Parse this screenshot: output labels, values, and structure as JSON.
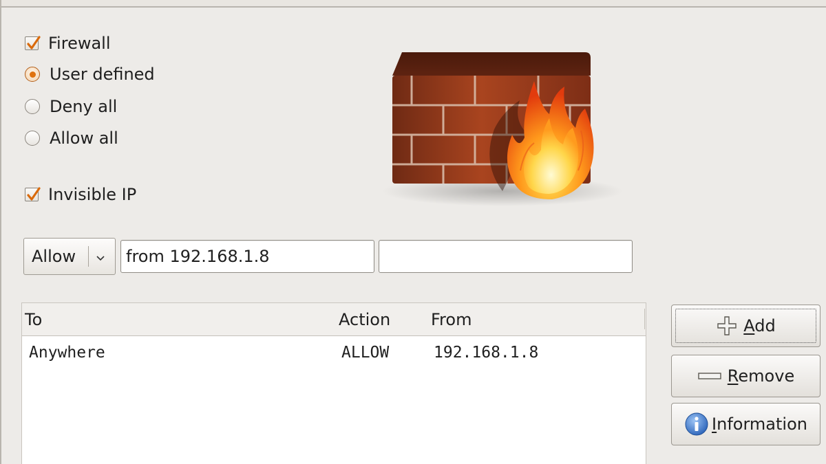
{
  "options": {
    "firewall": {
      "label": "Firewall",
      "checked": true
    },
    "user_defined": {
      "label": "User defined",
      "selected": true
    },
    "deny_all": {
      "label": "Deny all",
      "selected": false
    },
    "allow_all": {
      "label": "Allow all",
      "selected": false
    },
    "invisible_ip": {
      "label": "Invisible IP",
      "checked": true
    }
  },
  "rule_editor": {
    "policy_selected": "Allow",
    "from_value": "from 192.168.1.8",
    "extra_value": ""
  },
  "rules_table": {
    "columns": [
      "To",
      "Action",
      "From"
    ],
    "rows": [
      [
        "Anywhere",
        "ALLOW",
        "192.168.1.8"
      ]
    ]
  },
  "buttons": {
    "add": {
      "mnemonic": "A",
      "rest": "dd"
    },
    "remove": {
      "mnemonic": "R",
      "rest": "emove"
    },
    "information": {
      "mnemonic": "I",
      "rest": "nformation"
    }
  },
  "colors": {
    "accent": "#e0730f",
    "window_bg": "#edebe8",
    "info_blue": "#3f7fd6"
  },
  "icons": {
    "logo": "firewall-brick-wall-flames-icon",
    "add": "plus-icon",
    "remove": "minus-icon",
    "information": "info-icon",
    "dropdown": "chevron-down-icon"
  }
}
